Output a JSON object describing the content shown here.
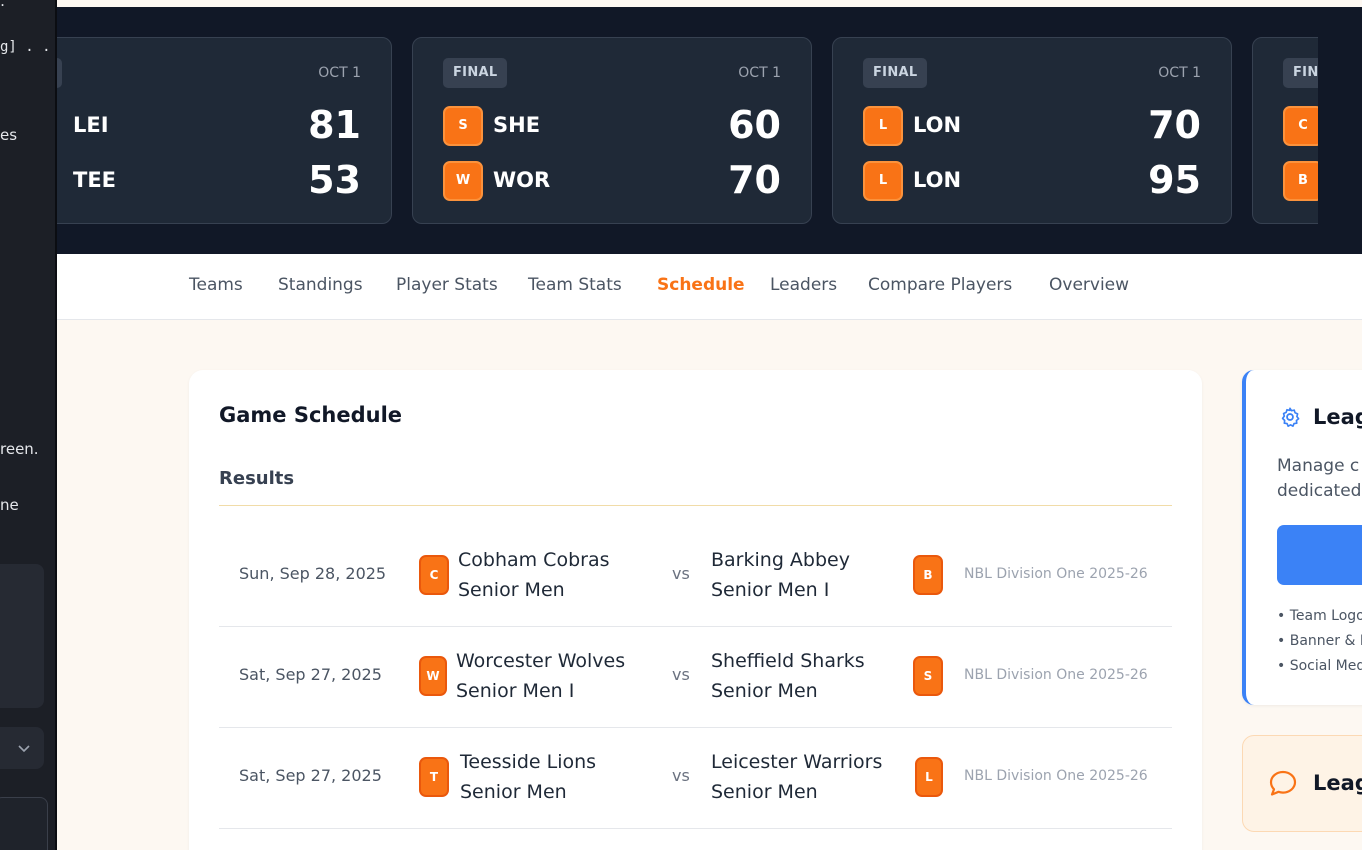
{
  "left_panel": {
    "fragments": [
      ":",
      "g] . . .",
      "es",
      "reen.",
      "ne"
    ]
  },
  "scoreboard": {
    "games": [
      {
        "status": "AL",
        "date": "OCT 1",
        "home": {
          "logo": "",
          "abbr": "LEI",
          "score": "81"
        },
        "away": {
          "logo": "",
          "abbr": "TEE",
          "score": "53"
        }
      },
      {
        "status": "FINAL",
        "date": "OCT 1",
        "home": {
          "logo": "S",
          "abbr": "SHE",
          "score": "60"
        },
        "away": {
          "logo": "W",
          "abbr": "WOR",
          "score": "70"
        }
      },
      {
        "status": "FINAL",
        "date": "OCT 1",
        "home": {
          "logo": "L",
          "abbr": "LON",
          "score": "70"
        },
        "away": {
          "logo": "L",
          "abbr": "LON",
          "score": "95"
        }
      },
      {
        "status": "FINA",
        "date": "",
        "home": {
          "logo": "C",
          "abbr": "",
          "score": ""
        },
        "away": {
          "logo": "B",
          "abbr": "",
          "score": ""
        }
      }
    ]
  },
  "nav": {
    "items": [
      "Teams",
      "Standings",
      "Player Stats",
      "Team Stats",
      "Schedule",
      "Leaders",
      "Compare Players",
      "Overview"
    ],
    "active": "Schedule"
  },
  "schedule": {
    "title": "Game Schedule",
    "section": "Results",
    "vs_label": "vs",
    "games": [
      {
        "date": "Sun, Sep 28, 2025",
        "home_logo": "C",
        "home_line1": "Cobham Cobras",
        "home_line2": "Senior Men",
        "away_line1": "Barking Abbey",
        "away_line2": "Senior Men I",
        "away_logo": "B",
        "league": "NBL Division One 2025-26"
      },
      {
        "date": "Sat, Sep 27, 2025",
        "home_logo": "W",
        "home_line1": "Worcester Wolves",
        "home_line2": "Senior Men I",
        "away_line1": "Sheffield Sharks",
        "away_line2": "Senior Men",
        "away_logo": "S",
        "league": "NBL Division One 2025-26"
      },
      {
        "date": "Sat, Sep 27, 2025",
        "home_logo": "T",
        "home_line1": "Teesside Lions",
        "home_line2": "Senior Men",
        "away_line1": "Leicester Warriors",
        "away_line2": "Senior Men",
        "away_logo": "L",
        "league": "NBL Division One 2025-26"
      }
    ]
  },
  "side_panel": {
    "card1": {
      "title": "Leag",
      "desc_line1": "Manage c",
      "desc_line2": "dedicated",
      "bullets": [
        "• Team Logo",
        "• Banner & I",
        "• Social Med"
      ]
    },
    "card2": {
      "title": "Leag"
    }
  },
  "colors": {
    "accent": "#f97316",
    "banner_bg": "#111827",
    "card_bg": "#1f2937",
    "page_bg": "#fdf8f2",
    "blue": "#3b82f6"
  }
}
